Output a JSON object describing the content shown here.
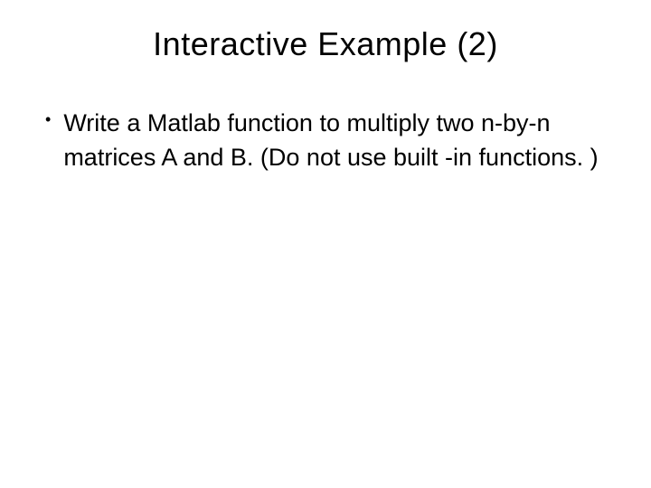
{
  "slide": {
    "title": "Interactive Example (2)",
    "bullet": {
      "marker": "•",
      "text": "Write a Matlab function to multiply two n-by-n matrices A and B.  (Do not use built -in functions. )"
    }
  }
}
